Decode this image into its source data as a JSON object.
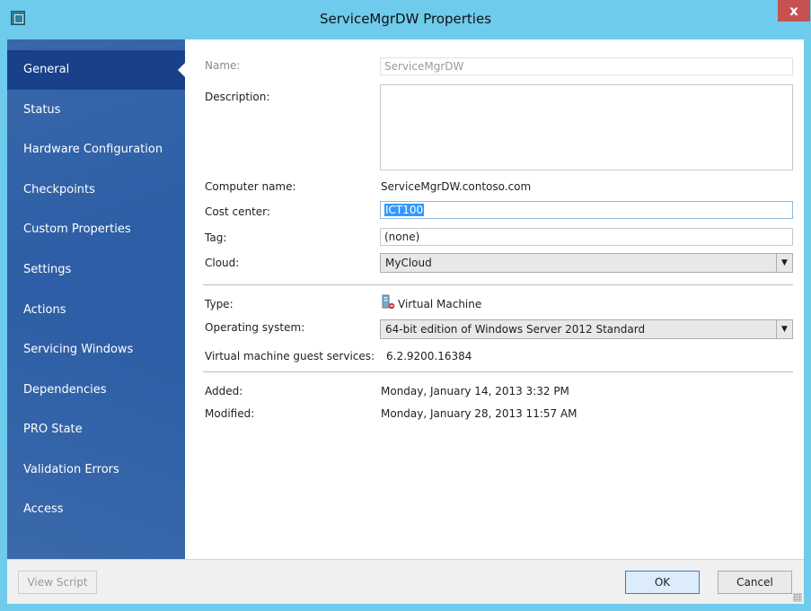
{
  "window": {
    "title": "ServiceMgrDW Properties",
    "close_glyph": "x",
    "accent_color": "#6fcbec",
    "sidebar_color": "#2e5fa6"
  },
  "sidebar": {
    "selected": "General",
    "items": [
      {
        "label": "General"
      },
      {
        "label": "Status"
      },
      {
        "label": "Hardware Configuration"
      },
      {
        "label": "Checkpoints"
      },
      {
        "label": "Custom Properties"
      },
      {
        "label": "Settings"
      },
      {
        "label": "Actions"
      },
      {
        "label": "Servicing Windows"
      },
      {
        "label": "Dependencies"
      },
      {
        "label": "PRO State"
      },
      {
        "label": "Validation Errors"
      },
      {
        "label": "Access"
      }
    ]
  },
  "general": {
    "name_label": "Name:",
    "name_value": "ServiceMgrDW",
    "description_label": "Description:",
    "description_value": "",
    "computer_name_label": "Computer name:",
    "computer_name_value": "ServiceMgrDW.contoso.com",
    "cost_center_label": "Cost center:",
    "cost_center_value": "ICT100",
    "tag_label": "Tag:",
    "tag_value": "(none)",
    "cloud_label": "Cloud:",
    "cloud_value": "MyCloud",
    "type_label": "Type:",
    "type_value": "Virtual Machine",
    "type_icon": "virtual-machine-icon",
    "os_label": "Operating system:",
    "os_value": "64-bit edition of Windows Server 2012 Standard",
    "guest_services_label": "Virtual machine guest services:",
    "guest_services_value": "6.2.9200.16384",
    "added_label": "Added:",
    "added_value": "Monday, January 14, 2013 3:32 PM",
    "modified_label": "Modified:",
    "modified_value": "Monday, January 28, 2013 11:57 AM"
  },
  "footer": {
    "view_script_label": "View Script",
    "ok_label": "OK",
    "cancel_label": "Cancel"
  }
}
